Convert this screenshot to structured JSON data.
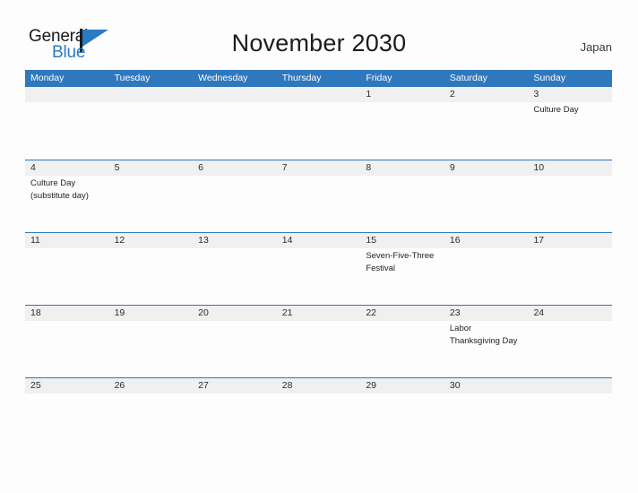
{
  "brand": {
    "name_part1": "General",
    "name_part2": "Blue",
    "flag_icon": "flag-triangle-icon"
  },
  "header": {
    "title": "November 2030",
    "country": "Japan"
  },
  "colors": {
    "header_blue": "#2f78bd",
    "brand_blue": "#2a7ac4",
    "date_band_gray": "#f0f0f0",
    "page_background": "#fdfdfd",
    "text_dark": "#222222"
  },
  "weekdays": [
    "Monday",
    "Tuesday",
    "Wednesday",
    "Thursday",
    "Friday",
    "Saturday",
    "Sunday"
  ],
  "weeks": [
    {
      "days": [
        {
          "number": "",
          "events": []
        },
        {
          "number": "",
          "events": []
        },
        {
          "number": "",
          "events": []
        },
        {
          "number": "",
          "events": []
        },
        {
          "number": "1",
          "events": []
        },
        {
          "number": "2",
          "events": []
        },
        {
          "number": "3",
          "events": [
            "Culture Day"
          ]
        }
      ]
    },
    {
      "days": [
        {
          "number": "4",
          "events": [
            "Culture Day",
            "(substitute day)"
          ]
        },
        {
          "number": "5",
          "events": []
        },
        {
          "number": "6",
          "events": []
        },
        {
          "number": "7",
          "events": []
        },
        {
          "number": "8",
          "events": []
        },
        {
          "number": "9",
          "events": []
        },
        {
          "number": "10",
          "events": []
        }
      ]
    },
    {
      "days": [
        {
          "number": "11",
          "events": []
        },
        {
          "number": "12",
          "events": []
        },
        {
          "number": "13",
          "events": []
        },
        {
          "number": "14",
          "events": []
        },
        {
          "number": "15",
          "events": [
            "Seven-Five-Three",
            "Festival"
          ]
        },
        {
          "number": "16",
          "events": []
        },
        {
          "number": "17",
          "events": []
        }
      ]
    },
    {
      "days": [
        {
          "number": "18",
          "events": []
        },
        {
          "number": "19",
          "events": []
        },
        {
          "number": "20",
          "events": []
        },
        {
          "number": "21",
          "events": []
        },
        {
          "number": "22",
          "events": []
        },
        {
          "number": "23",
          "events": [
            "Labor",
            "Thanksgiving Day"
          ]
        },
        {
          "number": "24",
          "events": []
        }
      ]
    },
    {
      "days": [
        {
          "number": "25",
          "events": []
        },
        {
          "number": "26",
          "events": []
        },
        {
          "number": "27",
          "events": []
        },
        {
          "number": "28",
          "events": []
        },
        {
          "number": "29",
          "events": []
        },
        {
          "number": "30",
          "events": []
        },
        {
          "number": "",
          "events": []
        }
      ]
    }
  ]
}
